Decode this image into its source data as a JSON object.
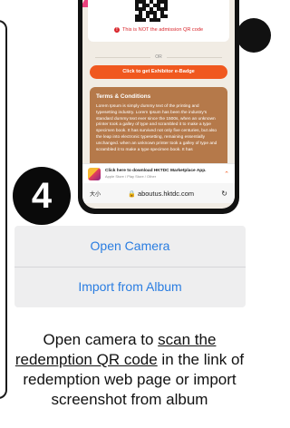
{
  "qr_section": {
    "warning": "This is NOT the admission QR code"
  },
  "divider_or": "OR",
  "exhibitor_button": "Click to get Exhibitor e-Badge",
  "terms": {
    "title": "Terms & Conditions",
    "body": "Lorem Ipsum is simply dummy text of the printing and typesetting industry. Lorem Ipsum has been the industry's standard dummy text ever since the 1500s, when an unknown printer took a galley of type and scrambled it to make a type specimen book. It has survived not only five centuries, but also the leap into electronic typesetting, remaining essentially unchanged. when an unknown printer took a galley of type and scrambled it to make a type specimen book. It has"
  },
  "app_banner": {
    "title": "Click here to download HKTDC Marketplace App.",
    "subtitle": "Apple Store / Play Store / Other"
  },
  "url_bar": {
    "text_size": "大小",
    "url": "aboutus.hktdc.com"
  },
  "step_number": "4",
  "action_sheet": {
    "open_camera": "Open Camera",
    "import_album": "Import from Album"
  },
  "instructions": {
    "part1": "Open camera to ",
    "link": "scan the redemption QR code",
    "part2": " in the link of redemption web page or import screenshot from album"
  },
  "colors": {
    "accent_orange": "#f0581f",
    "ios_blue": "#2a7de1",
    "terms_brown": "#b5794a",
    "warning_red": "#d9262c"
  },
  "icons": {
    "warning": "warning-icon",
    "lock": "lock-icon",
    "reload": "reload-icon",
    "chevron": "chevron-up-icon"
  }
}
